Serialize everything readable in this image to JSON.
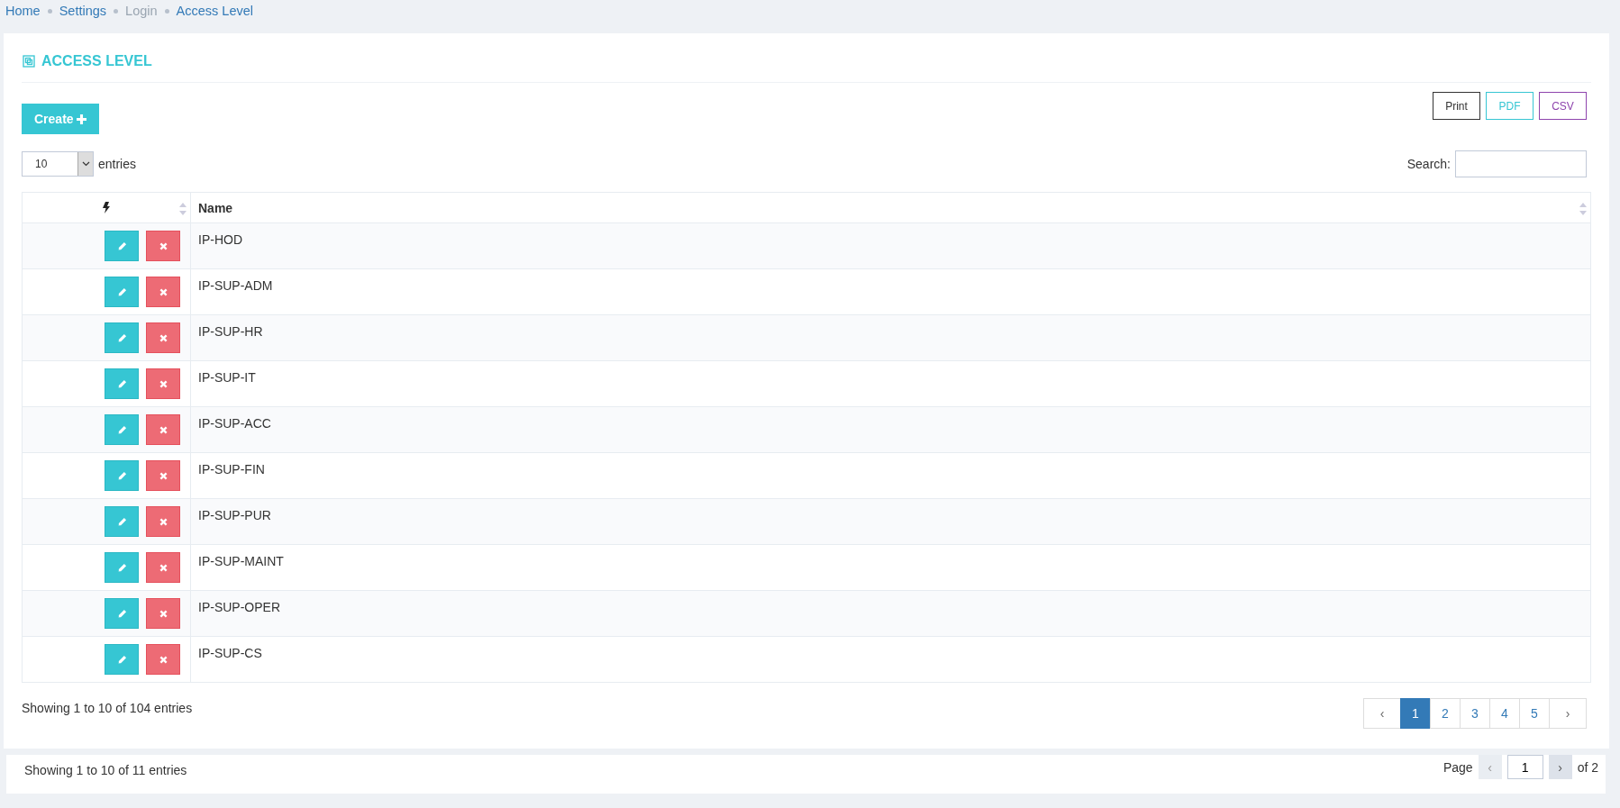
{
  "breadcrumb": [
    {
      "label": "Home",
      "disabled": false
    },
    {
      "label": "Settings",
      "disabled": false
    },
    {
      "label": "Login",
      "disabled": true
    },
    {
      "label": "Access Level",
      "disabled": false
    }
  ],
  "title": "ACCESS LEVEL",
  "create_button": "Create",
  "export_buttons": [
    {
      "label": "Print",
      "color": "#333333"
    },
    {
      "label": "PDF",
      "color": "#36c6d3"
    },
    {
      "label": "CSV",
      "color": "#8e44ad"
    }
  ],
  "length": {
    "value": "10",
    "label": "entries"
  },
  "search": {
    "label": "Search:"
  },
  "table": {
    "columns": [
      {
        "kind": "icon"
      },
      {
        "kind": "text",
        "label": "Name"
      }
    ],
    "rows": [
      "IP-HOD",
      "IP-SUP-ADM",
      "IP-SUP-HR",
      "IP-SUP-IT",
      "IP-SUP-ACC",
      "IP-SUP-FIN",
      "IP-SUP-PUR",
      "IP-SUP-MAINT",
      "IP-SUP-OPER",
      "IP-SUP-CS"
    ]
  },
  "info": "Showing 1 to 10 of 104 entries",
  "pagination": [
    {
      "label": "‹",
      "selected": false
    },
    {
      "label": "1",
      "selected": true
    },
    {
      "label": "2",
      "selected": false
    },
    {
      "label": "3",
      "selected": false
    },
    {
      "label": "4",
      "selected": false
    },
    {
      "label": "5",
      "selected": false
    },
    {
      "label": "›",
      "selected": false
    }
  ],
  "footer": {
    "info": "Showing 1 to 10 of 11 entries",
    "page_label": "Page",
    "prev": "‹",
    "page": "1",
    "next": "›",
    "of": "of 2"
  }
}
